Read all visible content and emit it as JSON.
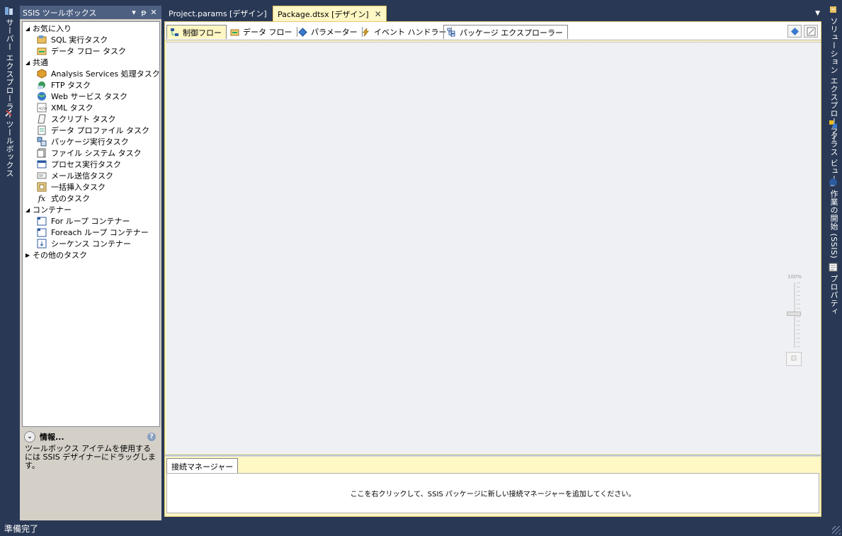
{
  "left_strip": {
    "tabs": [
      {
        "label": "サーバー エクスプローラー",
        "icon": "server-explorer-icon"
      },
      {
        "label": "ツールボックス",
        "icon": "toolbox-icon"
      }
    ]
  },
  "toolbox": {
    "title": "SSIS ツールボックス",
    "buttons": {
      "dropdown": "▾",
      "pin": "ᵽ",
      "close": "✕"
    },
    "categories": [
      {
        "label": "お気に入り",
        "expanded": true,
        "items": [
          {
            "label": "SQL 実行タスク",
            "icon": "sql-task-icon"
          },
          {
            "label": "データ フロー タスク",
            "icon": "data-flow-task-icon"
          }
        ]
      },
      {
        "label": "共通",
        "expanded": true,
        "items": [
          {
            "label": "Analysis Services 処理タスク",
            "icon": "analysis-services-icon"
          },
          {
            "label": "FTP タスク",
            "icon": "ftp-icon"
          },
          {
            "label": "Web サービス タスク",
            "icon": "web-service-icon"
          },
          {
            "label": "XML タスク",
            "icon": "xml-icon"
          },
          {
            "label": "スクリプト タスク",
            "icon": "script-icon"
          },
          {
            "label": "データ プロファイル タスク",
            "icon": "data-profile-icon"
          },
          {
            "label": "パッケージ実行タスク",
            "icon": "execute-package-icon"
          },
          {
            "label": "ファイル システム タスク",
            "icon": "file-system-icon"
          },
          {
            "label": "プロセス実行タスク",
            "icon": "execute-process-icon"
          },
          {
            "label": "メール送信タスク",
            "icon": "send-mail-icon"
          },
          {
            "label": "一括挿入タスク",
            "icon": "bulk-insert-icon"
          },
          {
            "label": "式のタスク",
            "icon": "expression-icon"
          }
        ]
      },
      {
        "label": "コンテナー",
        "expanded": true,
        "items": [
          {
            "label": "For ループ コンテナー",
            "icon": "for-loop-icon"
          },
          {
            "label": "Foreach ループ コンテナー",
            "icon": "foreach-loop-icon"
          },
          {
            "label": "シーケンス コンテナー",
            "icon": "sequence-icon"
          }
        ]
      },
      {
        "label": "その他のタスク",
        "expanded": false,
        "items": []
      }
    ],
    "info": {
      "title": "情報...",
      "text": "ツールボックス アイテムを使用するには SSIS デザイナーにドラッグします。"
    }
  },
  "doc_tabs": [
    {
      "label": "Project.params [デザイン]",
      "active": false
    },
    {
      "label": "Package.dtsx [デザイン]",
      "active": true
    }
  ],
  "designer": {
    "tabs": [
      {
        "label": "制御フロー",
        "icon": "control-flow-icon",
        "active": true
      },
      {
        "label": "データ フロー",
        "icon": "data-flow-icon",
        "active": false
      },
      {
        "label": "パラメーター",
        "icon": "parameters-icon",
        "active": false
      },
      {
        "label": "イベント ハンドラー",
        "icon": "event-handler-icon",
        "active": false
      },
      {
        "label": "パッケージ エクスプローラー",
        "icon": "package-explorer-icon",
        "active": false
      }
    ],
    "zoom_label": "100%",
    "connection_manager": {
      "tab_label": "接続マネージャー",
      "hint": "ここを右クリックして、SSIS パッケージに新しい接続マネージャーを追加してください。"
    }
  },
  "right_strip": {
    "tabs": [
      {
        "label": "ソリューション エクスプローラー",
        "icon": "solution-explorer-icon"
      },
      {
        "label": "クラス ビュー",
        "icon": "class-view-icon"
      },
      {
        "label": "作業の開始 (SSIS)",
        "icon": "getting-started-icon"
      },
      {
        "label": "プロパティ",
        "icon": "properties-icon"
      }
    ]
  },
  "status_bar": {
    "text": "準備完了"
  }
}
